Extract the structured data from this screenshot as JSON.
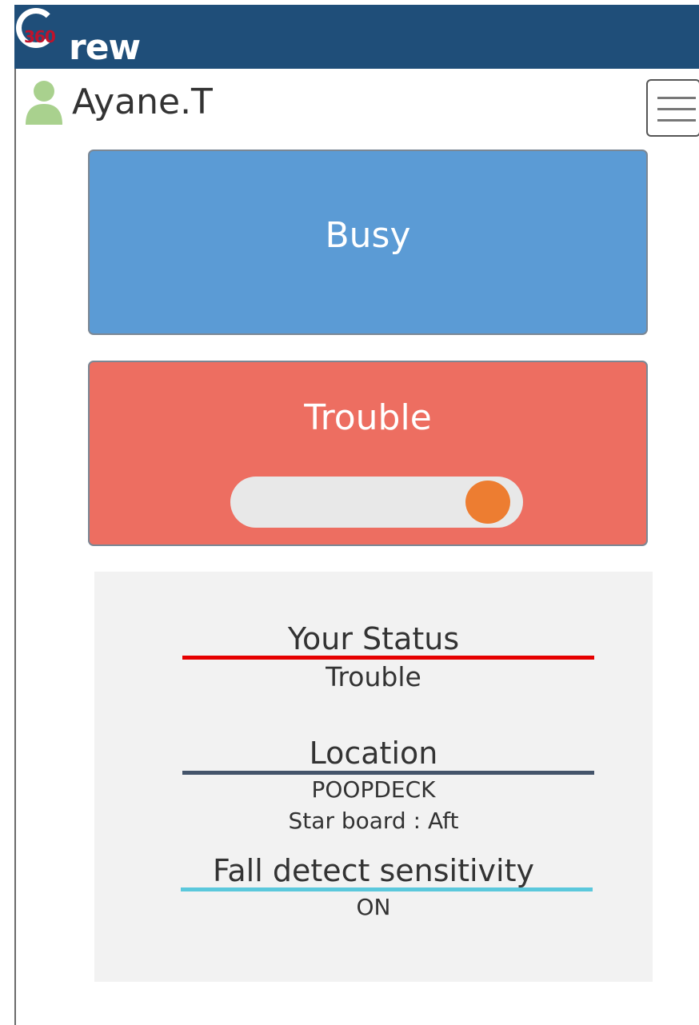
{
  "header": {
    "logo_number": "360",
    "logo_text": "rew"
  },
  "user": {
    "name": "Ayane.T",
    "icon": "user-icon"
  },
  "menu": {
    "icon": "hamburger-menu-icon"
  },
  "buttons": {
    "busy": "Busy",
    "trouble": "Trouble"
  },
  "toggle": {
    "state": "on"
  },
  "status": {
    "your_status_title": "Your Status",
    "your_status_value": "Trouble",
    "location_title": "Location",
    "location_value": "POOPDECK",
    "location_detail": "Star board : Aft",
    "fall_title": "Fall detect sensitivity",
    "fall_value": "ON"
  },
  "colors": {
    "header_bg": "#1f4e79",
    "busy": "#5b9bd5",
    "trouble": "#ed6e61",
    "toggle_knob": "#ed7d31",
    "status_line": "#e60000",
    "location_line": "#44546a",
    "fall_line": "#5bc8dc"
  }
}
